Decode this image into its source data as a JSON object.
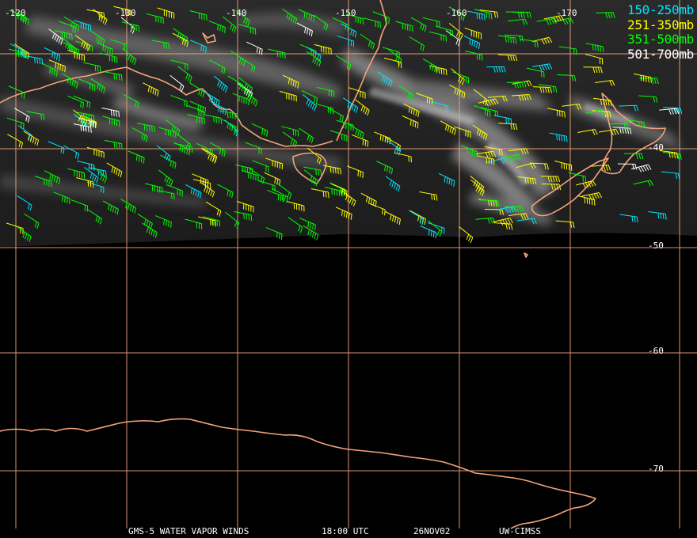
{
  "legend": [
    {
      "label": "150-250mb",
      "color": "#00e5ff"
    },
    {
      "label": "251-350mb",
      "color": "#ffff00"
    },
    {
      "label": "351-500mb",
      "color": "#00ff00"
    },
    {
      "label": "501-700mb",
      "color": "#ffffff"
    }
  ],
  "longitude_labels": [
    "-120",
    "-130",
    "-140",
    "-150",
    "-160",
    "-170"
  ],
  "latitude_labels": [
    "-40",
    "-50",
    "-60",
    "-70"
  ],
  "footer": {
    "product": "GMS-5 WATER VAPOR WINDS",
    "time": "18:00 UTC",
    "date": "26NOV02",
    "source": "UW-CIMSS"
  },
  "colors": {
    "grid": "#f4a47c",
    "coast": "#f4a47c",
    "background": "#000000"
  }
}
